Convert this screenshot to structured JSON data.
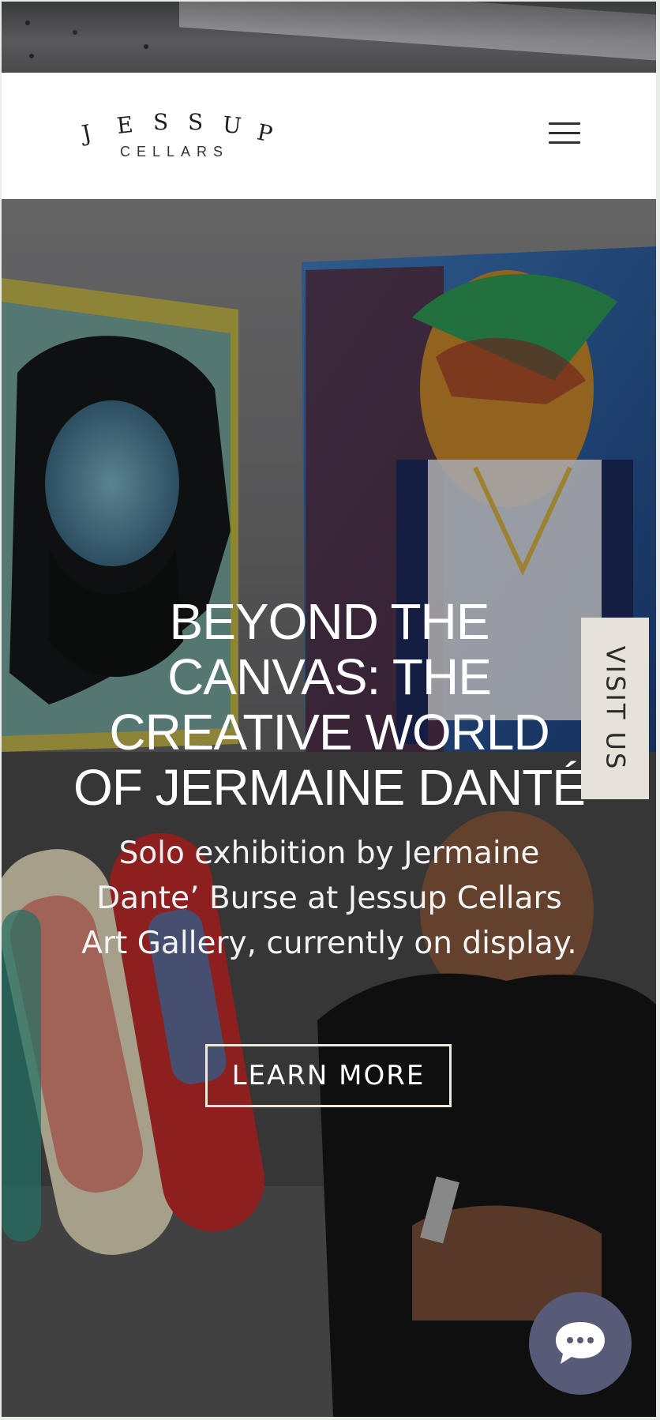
{
  "header": {
    "logo_letters": [
      "J",
      "E",
      "S",
      "S",
      "U",
      "P"
    ],
    "logo_sub": "CELLARS",
    "menu_icon": "hamburger-menu-icon"
  },
  "hero": {
    "headline": "BEYOND THE CANVAS: THE CREATIVE WORLD OF JERMAINE DANTÉ",
    "subheadline": "Solo exhibition by Jermaine Dante’ Burse at Jessup Cellars Art Gallery, currently on display.",
    "cta_label": "LEARN MORE"
  },
  "visit_tab": {
    "label": "VISIT US"
  },
  "chat": {
    "icon": "chat-bubble-icon"
  },
  "colors": {
    "header_bg": "#ffffff",
    "visit_tab_bg": "#e6e2d9",
    "cta_border": "#eee8de",
    "chat_bg": "#585b77"
  }
}
